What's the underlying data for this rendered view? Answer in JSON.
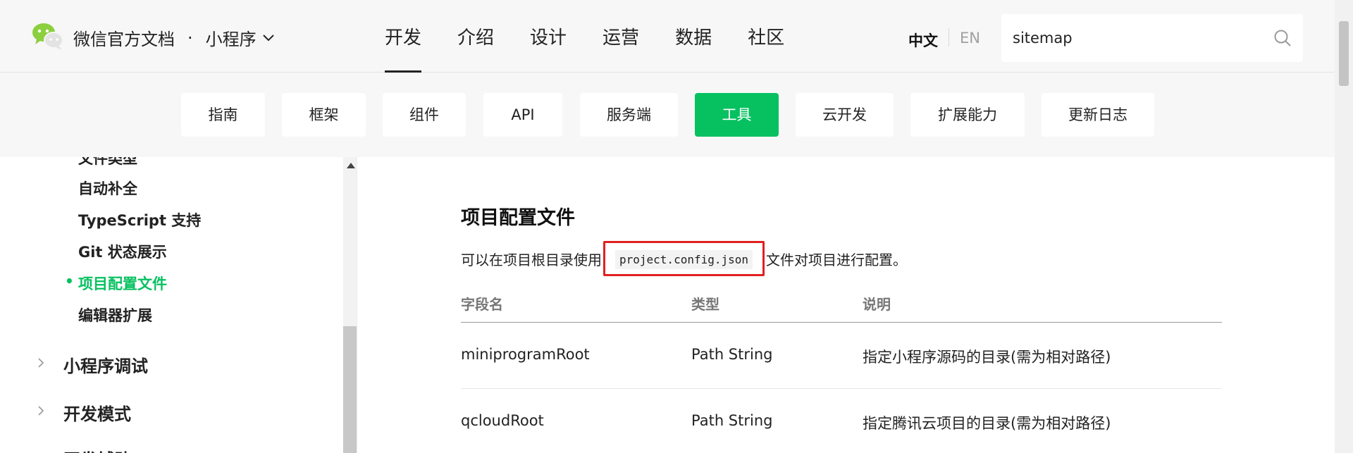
{
  "header": {
    "brand": "微信官方文档",
    "separator": "·",
    "product": "小程序",
    "nav": [
      "开发",
      "介绍",
      "设计",
      "运营",
      "数据",
      "社区"
    ],
    "active_nav": "开发",
    "lang_zh": "中文",
    "lang_en": "EN",
    "search": {
      "value": "sitemap"
    }
  },
  "subnav": {
    "tabs": [
      "指南",
      "框架",
      "组件",
      "API",
      "服务端",
      "工具",
      "云开发",
      "扩展能力",
      "更新日志"
    ],
    "active_tab": "工具"
  },
  "sidebar": {
    "items": [
      {
        "label": "文件类型"
      },
      {
        "label": "自动补全"
      },
      {
        "label": "TypeScript 支持"
      },
      {
        "label": "Git 状态展示"
      },
      {
        "label": "项目配置文件",
        "active": true
      },
      {
        "label": "编辑器扩展"
      }
    ],
    "groups": [
      {
        "label": "小程序调试"
      },
      {
        "label": "开发模式"
      },
      {
        "label": "开发辅助"
      }
    ],
    "bullet": "•"
  },
  "content": {
    "title": "项目配置文件",
    "para_before": "可以在项目根目录使用",
    "para_code": "project.config.json",
    "para_after": "文件对项目进行配置。",
    "table": {
      "headers": [
        "字段名",
        "类型",
        "说明"
      ],
      "rows": [
        [
          "miniprogramRoot",
          "Path String",
          "指定小程序源码的目录(需为相对路径)"
        ],
        [
          "qcloudRoot",
          "Path String",
          "指定腾讯云项目的目录(需为相对路径)"
        ]
      ]
    }
  },
  "colors": {
    "accent": "#07c160",
    "highlight_border": "#e02020"
  }
}
